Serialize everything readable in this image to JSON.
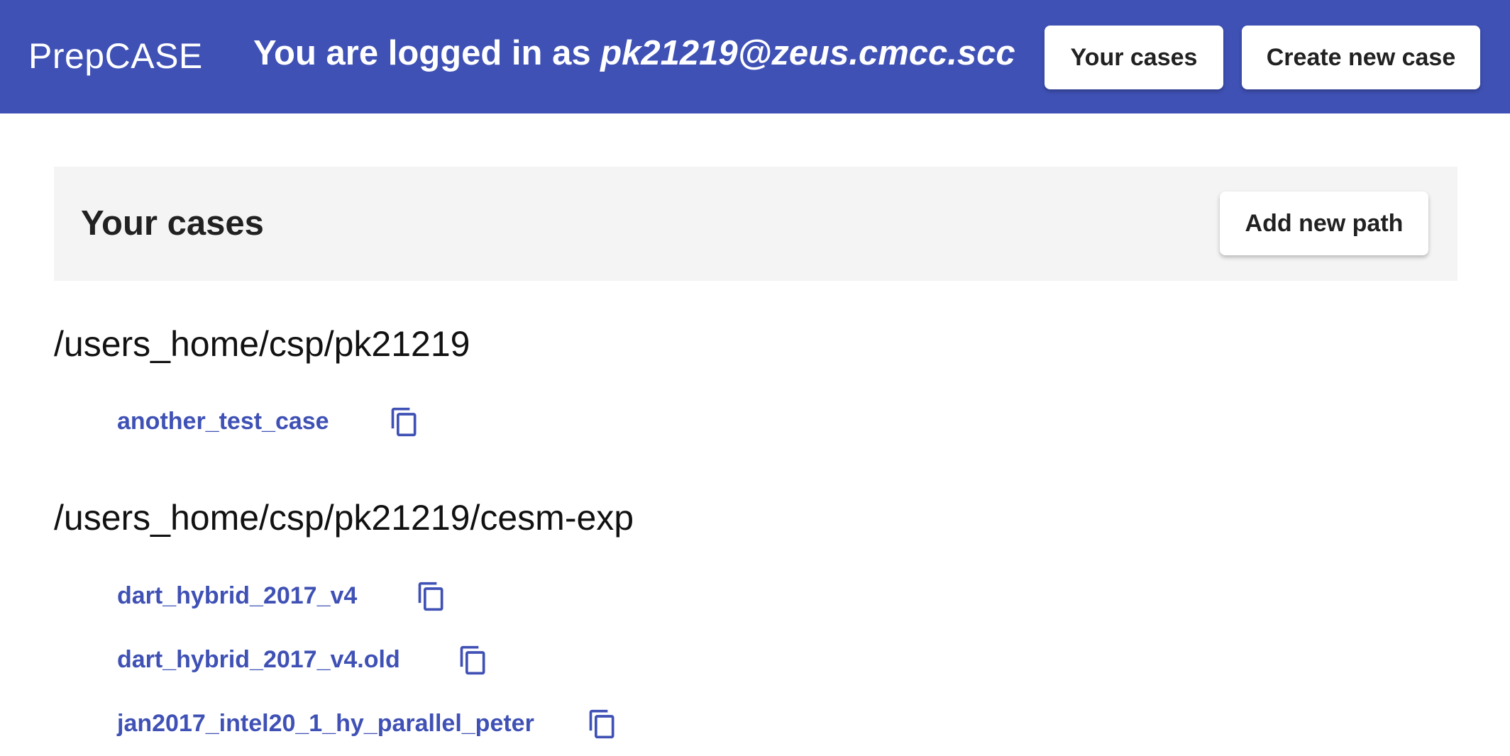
{
  "header": {
    "brand": "PrepCASE",
    "login_prefix": "You are logged in as ",
    "username": "pk21219@zeus.cmcc.scc",
    "your_cases_label": "Your cases",
    "create_case_label": "Create new case",
    "accent_color": "#3f51b5"
  },
  "cases_panel": {
    "title": "Your cases",
    "add_path_label": "Add new path"
  },
  "paths": [
    {
      "path": "/users_home/csp/pk21219",
      "cases": [
        {
          "name": "another_test_case",
          "icon": "copy-icon"
        }
      ]
    },
    {
      "path": "/users_home/csp/pk21219/cesm-exp",
      "cases": [
        {
          "name": "dart_hybrid_2017_v4",
          "icon": "copy-icon"
        },
        {
          "name": "dart_hybrid_2017_v4.old",
          "icon": "copy-icon"
        },
        {
          "name": "jan2017_intel20_1_hy_parallel_peter",
          "icon": "copy-icon"
        }
      ]
    }
  ]
}
